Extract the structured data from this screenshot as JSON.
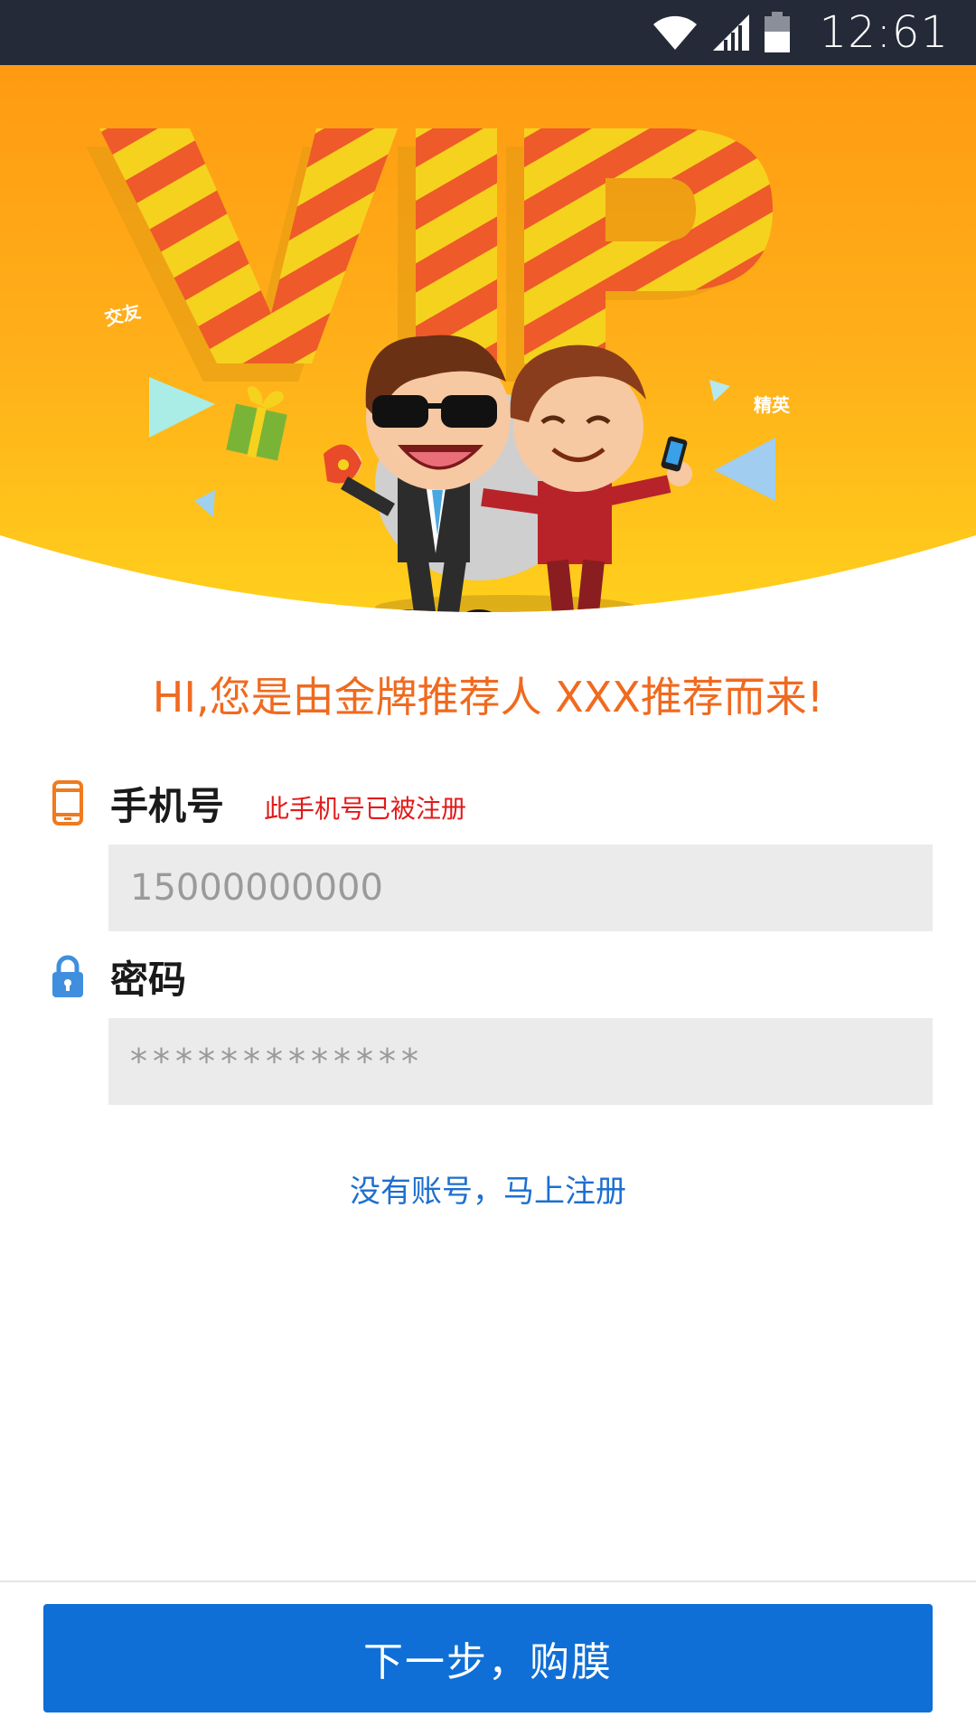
{
  "status_bar": {
    "time": "12:61",
    "icons": [
      "wifi-icon",
      "signal-icon",
      "battery-icon"
    ]
  },
  "hero": {
    "banner_text": "VIP",
    "tag_left": "交友",
    "tag_right": "精英"
  },
  "greeting": "HI,您是由金牌推荐人 XXX推荐而来!",
  "form": {
    "phone": {
      "label": "手机号",
      "error": "此手机号已被注册",
      "value": "15000000000",
      "icon": "phone-icon"
    },
    "password": {
      "label": "密码",
      "value": "*************",
      "icon": "lock-icon"
    }
  },
  "register_link": "没有账号，马上注册",
  "next_button": "下一步，购膜",
  "colors": {
    "accent_orange": "#f06a1f",
    "primary_blue": "#0f6fd6",
    "link_blue": "#1d6fcf",
    "error_red": "#e21a1a",
    "status_bar": "#252a38"
  }
}
